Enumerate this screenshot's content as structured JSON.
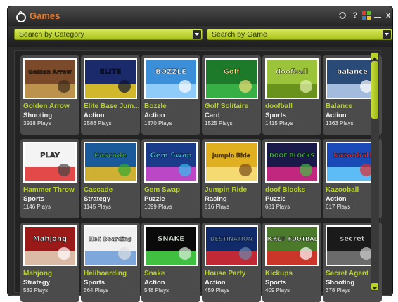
{
  "window": {
    "title": "Games",
    "title_color": "#f07a28",
    "accent_color": "#b8d228"
  },
  "toolbar": {
    "category_dropdown": {
      "label": "Search by Category"
    },
    "game_dropdown": {
      "label": "Search by Game"
    }
  },
  "controls": [
    "refresh-icon",
    "help-icon",
    "color-grid-icon",
    "minimize-icon",
    "close-icon"
  ],
  "games": [
    {
      "title": "Golden Arrow",
      "category": "Shooting",
      "plays": "3918 Plays",
      "thumb_text": "Golden Arrow"
    },
    {
      "title": "Elite Base Jum...",
      "category": "Action",
      "plays": "2586 Plays",
      "thumb_text": "ELITE"
    },
    {
      "title": "Bozzle",
      "category": "Action",
      "plays": "1870 Plays",
      "thumb_text": "BOZZLE"
    },
    {
      "title": "Golf Solitaire",
      "category": "Card",
      "plays": "1525 Plays",
      "thumb_text": "Golf"
    },
    {
      "title": "doofball",
      "category": "Sports",
      "plays": "1415 Plays",
      "thumb_text": "doofball"
    },
    {
      "title": "Balance",
      "category": "Action",
      "plays": "1363 Plays",
      "thumb_text": "balance"
    },
    {
      "title": "Hammer Throw",
      "category": "Sports",
      "plays": "1146 Plays",
      "thumb_text": "PLAY"
    },
    {
      "title": "Cascade",
      "category": "Strategy",
      "plays": "1145 Plays",
      "thumb_text": "Cascade"
    },
    {
      "title": "Gem Swap",
      "category": "Puzzle",
      "plays": "1099 Plays",
      "thumb_text": "Gem Swap"
    },
    {
      "title": "Jumpin Ride",
      "category": "Racing",
      "plays": "816 Plays",
      "thumb_text": "Jumpin Ride"
    },
    {
      "title": "doof Blocks",
      "category": "Puzzle",
      "plays": "681 Plays",
      "thumb_text": "DOOF BLOCKS"
    },
    {
      "title": "Kazooball",
      "category": "Action",
      "plays": "617 Plays",
      "thumb_text": "kazooball"
    },
    {
      "title": "Mahjong",
      "category": "Strategy",
      "plays": "582 Plays",
      "thumb_text": "Mahjong"
    },
    {
      "title": "Heliboarding",
      "category": "Sports",
      "plays": "564 Plays",
      "thumb_text": "Heli Boarding"
    },
    {
      "title": "Snake",
      "category": "Action",
      "plays": "548 Plays",
      "thumb_text": "SNAKE"
    },
    {
      "title": "House Party",
      "category": "Action",
      "plays": "459 Plays",
      "thumb_text": "DESTINATION"
    },
    {
      "title": "Kickups",
      "category": "Sports",
      "plays": "409 Plays",
      "thumb_text": "KICKUP FOOTBALL"
    },
    {
      "title": "Secret Agent",
      "category": "Shooting",
      "plays": "378 Plays",
      "thumb_text": "secret"
    }
  ]
}
